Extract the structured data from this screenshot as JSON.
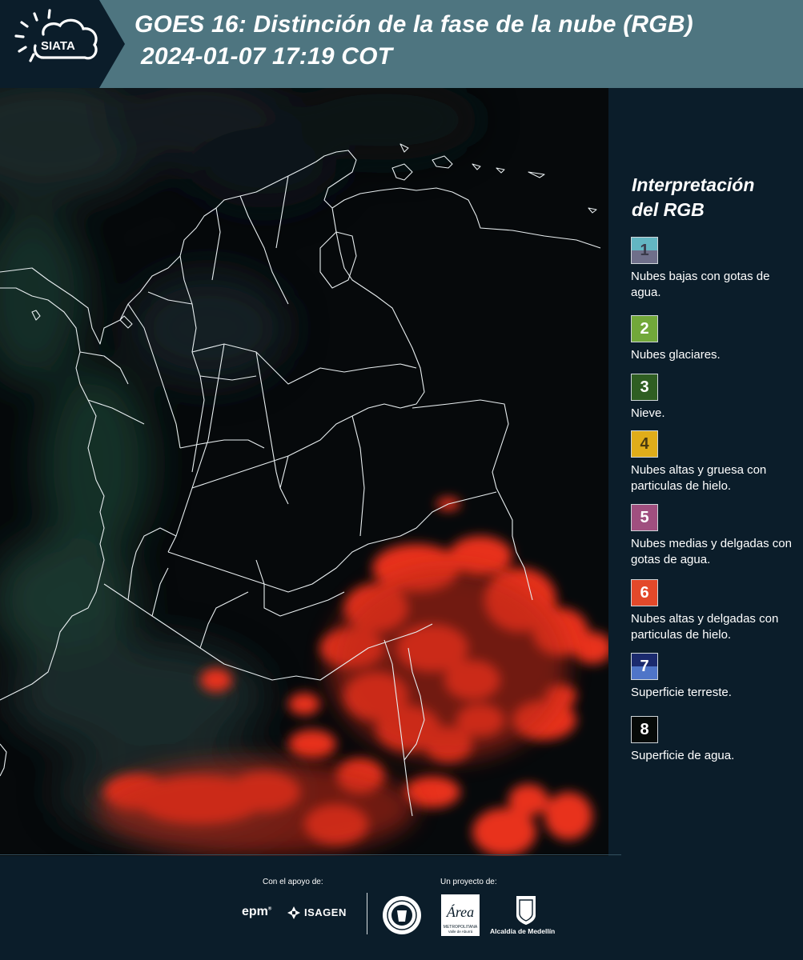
{
  "header": {
    "logo_text": "SIATA",
    "title_line1": "GOES 16: Distinción de la fase de la nube (RGB)",
    "title_line2": "2024-01-07 17:19 COT"
  },
  "legend": {
    "title_line1": "Interpretación",
    "title_line2": "del RGB",
    "items": [
      {
        "number": "1",
        "label": "Nubes bajas con gotas de agua.",
        "color_top": "#63b6c2",
        "color_bottom": "#6f6f8a",
        "num_color": "#3a3a4a"
      },
      {
        "number": "2",
        "label": "Nubes glaciares.",
        "color_top": "#72a83a",
        "color_bottom": "#72a83a",
        "num_color": "#ffffff"
      },
      {
        "number": "3",
        "label": "Nieve.",
        "color_top": "#2f5e22",
        "color_bottom": "#2f5e22",
        "num_color": "#ffffff"
      },
      {
        "number": "4",
        "label": "Nubes altas y gruesa con particulas de hielo.",
        "color_top": "#e0ad1a",
        "color_bottom": "#e0ad1a",
        "num_color": "#4a3a10"
      },
      {
        "number": "5",
        "label": "Nubes medias y delgadas con gotas de agua.",
        "color_top": "#a04f7f",
        "color_bottom": "#a04f7f",
        "num_color": "#ffffff"
      },
      {
        "number": "6",
        "label": "Nubes altas y delgadas con particulas de hielo.",
        "color_top": "#e3492a",
        "color_bottom": "#e3492a",
        "num_color": "#ffffff"
      },
      {
        "number": "7",
        "label": "Superficie terreste.",
        "color_top": "#1b2a6e",
        "color_bottom": "#4f75c8",
        "num_color": "#ffffff"
      },
      {
        "number": "8",
        "label": "Superficie de agua.",
        "color_top": "#060a08",
        "color_bottom": "#060a08",
        "num_color": "#ffffff"
      }
    ]
  },
  "footer": {
    "support_label": "Con el apoyo de:",
    "project_label": "Un proyecto de:",
    "sponsors": {
      "epm": "epm",
      "isagen": "ISAGEN"
    },
    "partners": {
      "area_text": "Área",
      "area_sub1": "METROPOLITANA",
      "area_sub2": "Valle de Aburrá",
      "alcaldia": "Alcaldía de Medellín"
    }
  },
  "colors": {
    "header_bg": "#4e7580",
    "header_dark": "#0b1d2a",
    "page_bg": "#0b1d2a",
    "cloud_red": "#e8321c",
    "border_line": "#e8eef0"
  }
}
